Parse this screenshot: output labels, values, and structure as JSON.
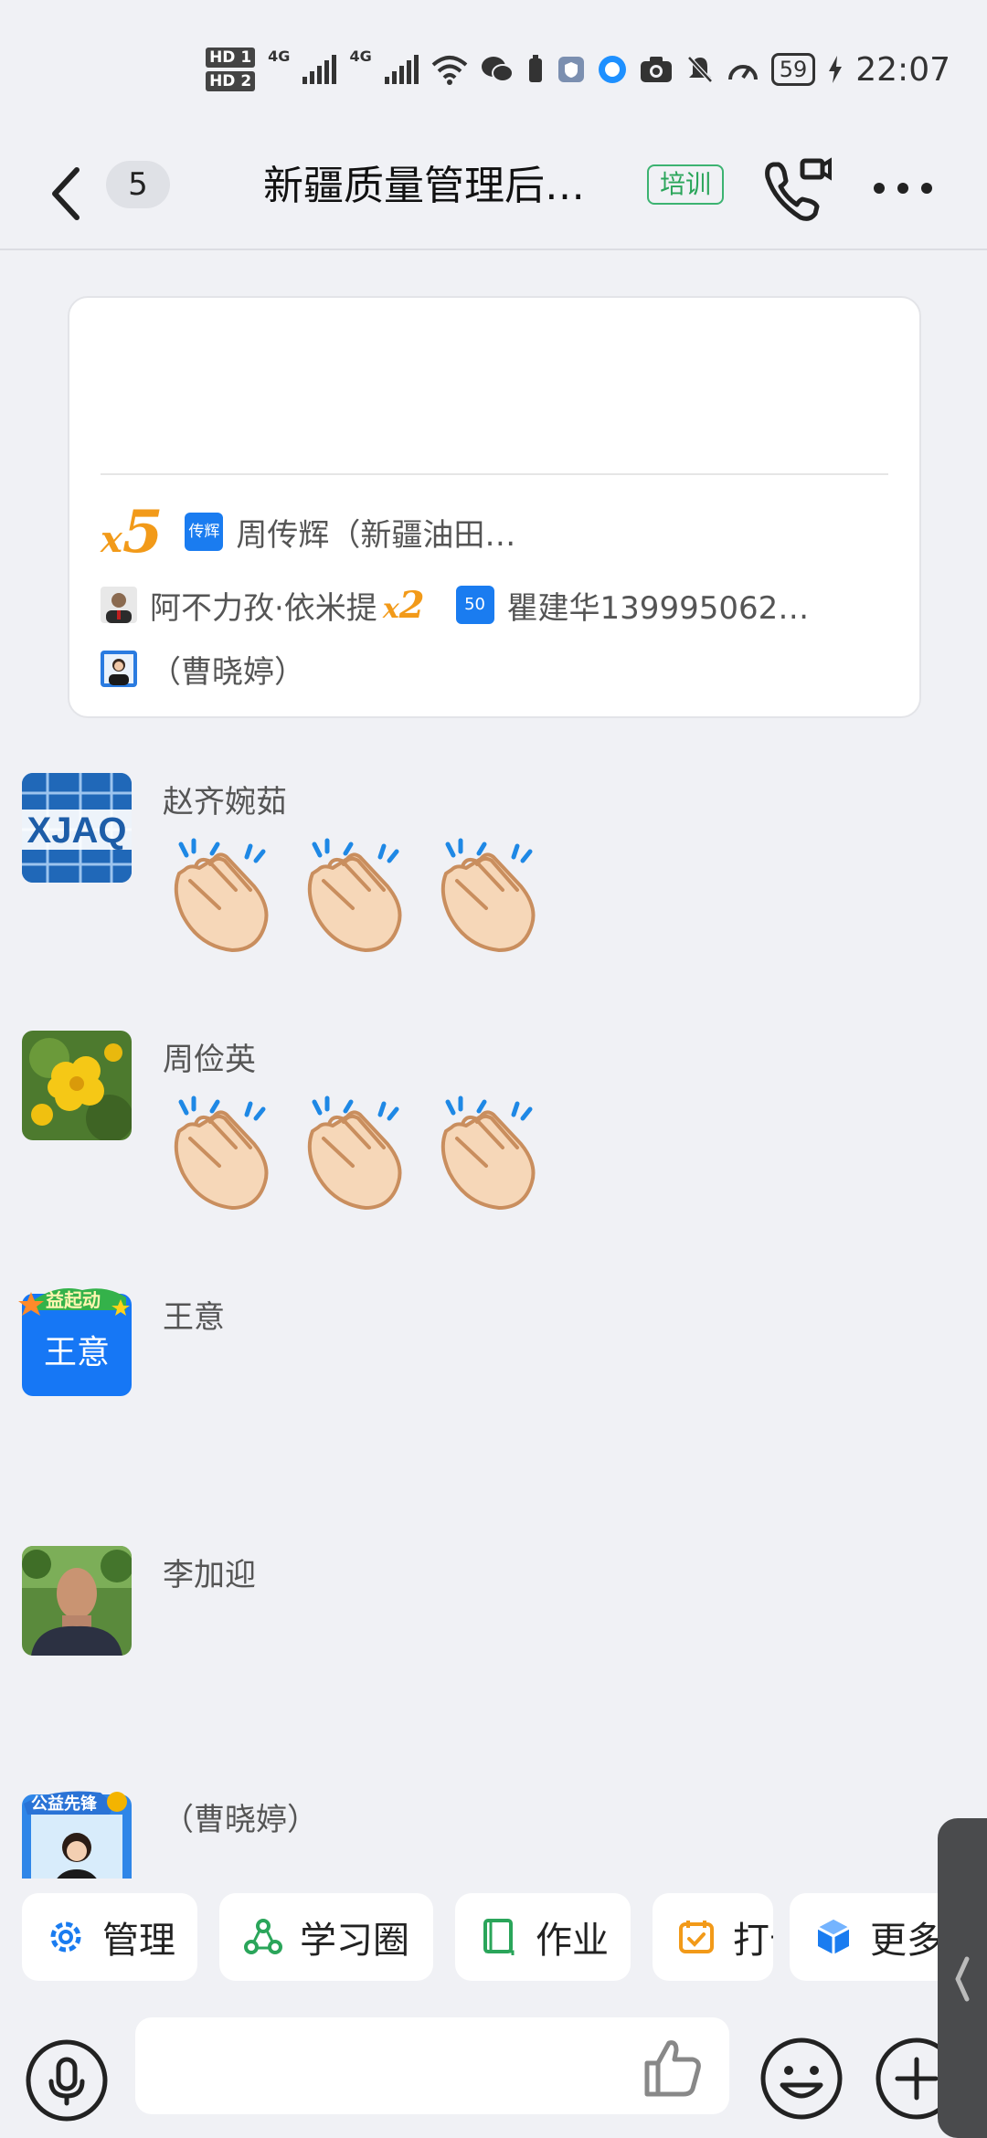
{
  "status_bar": {
    "hd1": "HD 1",
    "hd2": "HD 2",
    "net1": "4G",
    "net2": "4G",
    "battery": "59",
    "time": "22:07"
  },
  "header": {
    "back_count": "5",
    "title": "新疆质量管理后…",
    "tag": "培训"
  },
  "summary": {
    "row1": {
      "mult_x": "x",
      "mult_n": "5",
      "badge": "传辉",
      "name": "周传辉（新疆油田…"
    },
    "row2": {
      "name1": "阿不力孜·依米提",
      "mult_x": "x",
      "mult_n": "2",
      "badge": "50",
      "name2": "瞿建华139995062…"
    },
    "row3": {
      "name": "（曹晓婷）"
    }
  },
  "messages": [
    {
      "sender": "赵齐婉茹",
      "avatar_text": "XJAQ",
      "claps": 3
    },
    {
      "sender": "周俭英",
      "claps": 3
    },
    {
      "sender": "王意",
      "avatar_text": "王意",
      "avatar_banner": "益起动"
    },
    {
      "sender": "李加迎"
    },
    {
      "sender": "（曹晓婷）",
      "avatar_banner": "公益先锋"
    }
  ],
  "toolbar": {
    "manage": "管理",
    "circle": "学习圈",
    "homework": "作业",
    "checkin": "打卡",
    "more": "更多"
  },
  "input": {
    "placeholder": ""
  },
  "colors": {
    "accent": "#1a7cf0",
    "orange": "#f29a19",
    "green": "#2aa55a"
  }
}
